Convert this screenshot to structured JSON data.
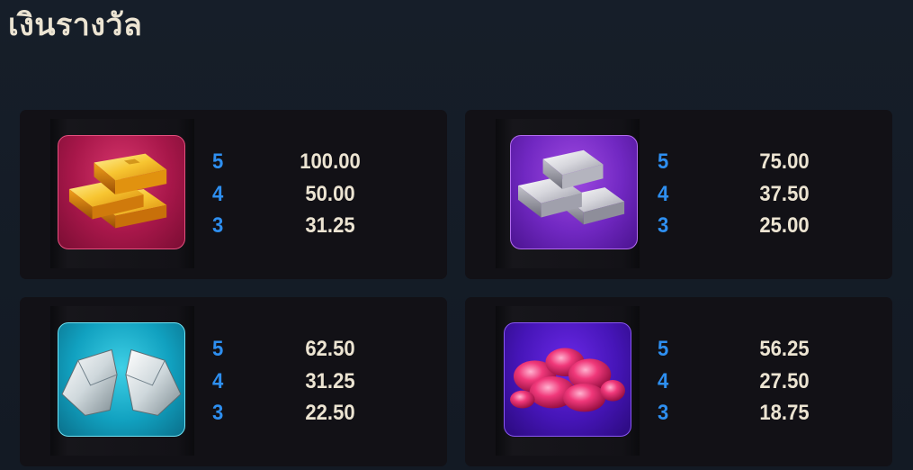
{
  "header": {
    "title": "เงินรางวัล"
  },
  "colors": {
    "background": "#141b25",
    "card": "#121116",
    "count_text": "#2e8ff0",
    "amount_text": "#ece4d2",
    "title_text": "#ece4d2"
  },
  "paytable": [
    {
      "symbol": "gold-bars-icon",
      "rows": [
        {
          "count": "5",
          "amount": "100.00"
        },
        {
          "count": "4",
          "amount": "50.00"
        },
        {
          "count": "3",
          "amount": "31.25"
        }
      ]
    },
    {
      "symbol": "silver-bars-icon",
      "rows": [
        {
          "count": "5",
          "amount": "75.00"
        },
        {
          "count": "4",
          "amount": "37.50"
        },
        {
          "count": "3",
          "amount": "25.00"
        }
      ]
    },
    {
      "symbol": "diamond-icon",
      "rows": [
        {
          "count": "5",
          "amount": "62.50"
        },
        {
          "count": "4",
          "amount": "31.25"
        },
        {
          "count": "3",
          "amount": "22.50"
        }
      ]
    },
    {
      "symbol": "rubies-icon",
      "rows": [
        {
          "count": "5",
          "amount": "56.25"
        },
        {
          "count": "4",
          "amount": "27.50"
        },
        {
          "count": "3",
          "amount": "18.75"
        }
      ]
    }
  ]
}
